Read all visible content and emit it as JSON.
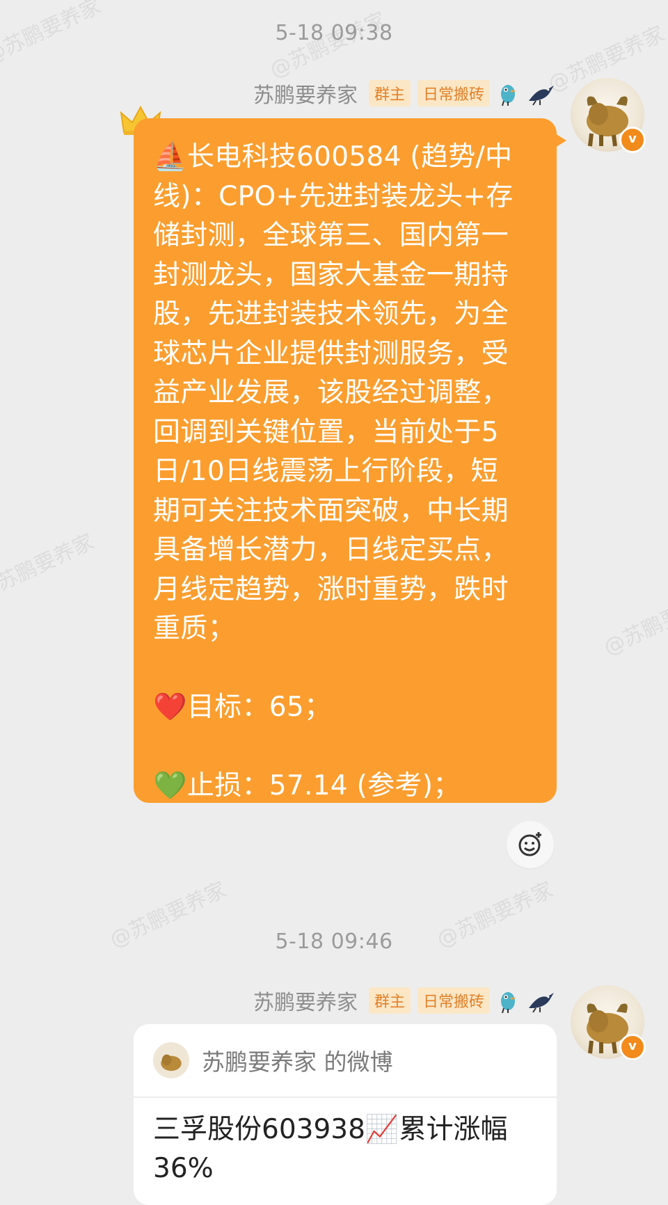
{
  "messages": [
    {
      "timestamp": "5-18 09:38",
      "sender": "苏鹏要养家",
      "badges": [
        "群主",
        "日常搬砖"
      ],
      "text_lines": [
        "⛵长电科技600584 (趋势/中",
        "线)：CPO+先进封装龙头+存",
        "储封测，全球第三、国内第一",
        "封测龙头，国家大基金一期持",
        "股，先进封装技术领先，为全",
        "球芯片企业提供封测服务，受",
        "益产业发展，该股经过调整，",
        "回调到关键位置，当前处于5",
        "日/10日线震荡上行阶段，短",
        "期可关注技术面突破，中长期",
        "具备增长潜力，日线定买点，",
        "月线定趋势，涨时重势，跌时",
        "重质；",
        "",
        "❤️目标：65；",
        "",
        "💚止损：57.14 (参考)；"
      ]
    },
    {
      "timestamp": "5-18 09:46",
      "sender": "苏鹏要养家",
      "badges": [
        "群主",
        "日常搬砖"
      ],
      "card": {
        "title": "苏鹏要养家 的微博",
        "body": "三孚股份603938📈累计涨幅36%"
      }
    }
  ],
  "watermark": "@苏鹏要养家",
  "colors": {
    "background": "#ededed",
    "bubble": "#fb9e2f",
    "badge_bg": "#fbe7c6",
    "badge_text": "#e2812b"
  }
}
